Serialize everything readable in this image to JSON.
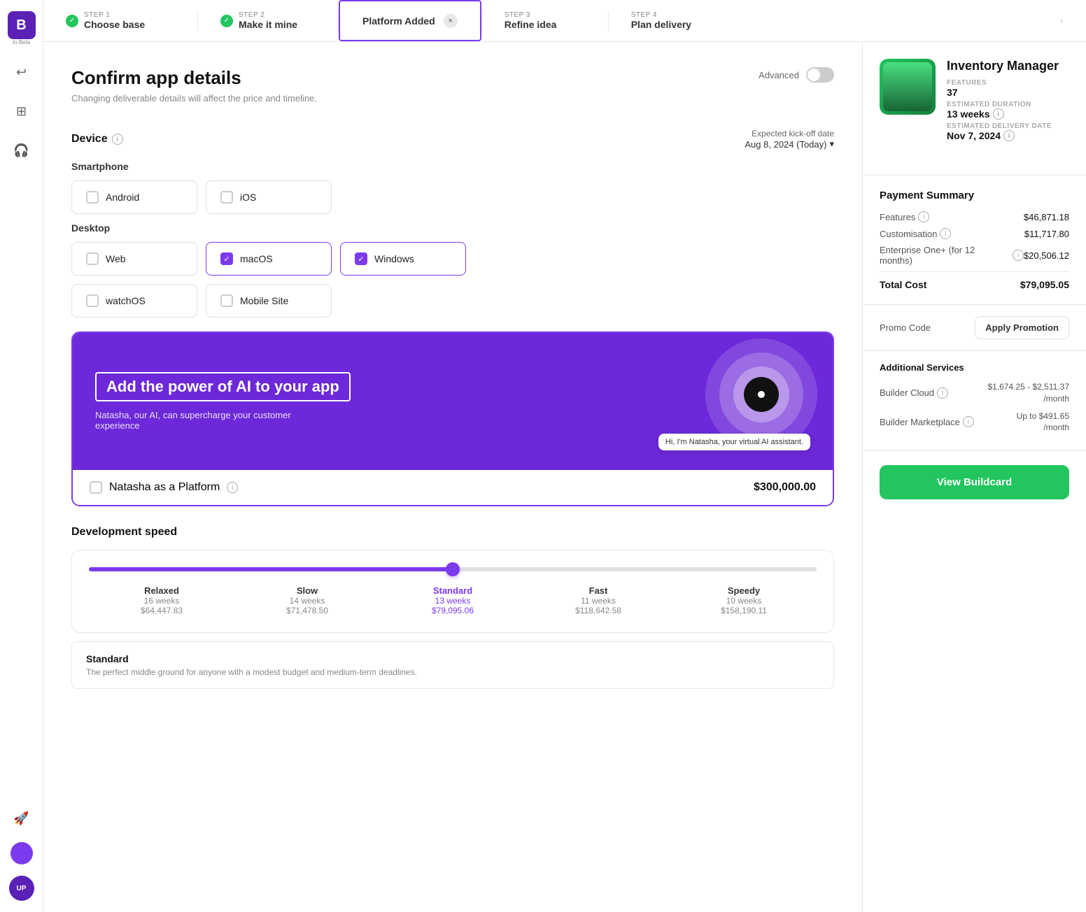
{
  "sidebar": {
    "logo": "B",
    "beta_label": "In Beta",
    "icons": [
      {
        "name": "undo-icon",
        "symbol": "↩"
      },
      {
        "name": "grid-icon",
        "symbol": "⊞"
      },
      {
        "name": "headset-icon",
        "symbol": "🎧"
      }
    ],
    "bottom_icons": [
      {
        "name": "rocket-icon",
        "symbol": "🚀"
      }
    ],
    "avatar_initials": "",
    "up_label": "UP"
  },
  "stepper": {
    "step1": {
      "num": "STEP 1",
      "label": "Choose base",
      "done": true
    },
    "step2": {
      "num": "STEP 2",
      "label": "Make it mine",
      "done": true
    },
    "step3": {
      "num": "",
      "label": "Platform Added",
      "active": true,
      "close": "×"
    },
    "step3b": {
      "num": "STEP 3",
      "label": "Refine idea"
    },
    "step4": {
      "num": "STEP 4",
      "label": "Plan delivery"
    }
  },
  "page": {
    "title": "Confirm app details",
    "subtitle": "Changing deliverable details will affect the price and timeline.",
    "advanced_label": "Advanced"
  },
  "device_section": {
    "title": "Device",
    "kickoff_label": "Expected kick-off date",
    "kickoff_date": "Aug 8, 2024 (Today)",
    "smartphone_label": "Smartphone",
    "desktop_label": "Desktop",
    "platforms": [
      {
        "id": "android",
        "label": "Android",
        "checked": false
      },
      {
        "id": "ios",
        "label": "iOS",
        "checked": false
      },
      {
        "id": "web",
        "label": "Web",
        "checked": false
      },
      {
        "id": "macos",
        "label": "macOS",
        "checked": true
      },
      {
        "id": "windows",
        "label": "Windows",
        "checked": true
      },
      {
        "id": "watchos",
        "label": "watchOS",
        "checked": false
      },
      {
        "id": "mobile-site",
        "label": "Mobile Site",
        "checked": false
      }
    ]
  },
  "ai_banner": {
    "title": "Add the power of AI to your app",
    "description": "Natasha, our AI, can supercharge your customer experience",
    "option_label": "Natasha as a Platform",
    "price": "$300,000.00",
    "bubble_text": "Hi, I'm Natasha, your virtual AI assistant."
  },
  "development_speed": {
    "title": "Development speed",
    "speeds": [
      {
        "name": "Relaxed",
        "weeks": "16 weeks",
        "price": "$64,447.83"
      },
      {
        "name": "Slow",
        "weeks": "14 weeks",
        "price": "$71,478.50"
      },
      {
        "name": "Standard",
        "weeks": "13 weeks",
        "price": "$79,095.06",
        "active": true
      },
      {
        "name": "Fast",
        "weeks": "11 weeks",
        "price": "$118,642.58"
      },
      {
        "name": "Speedy",
        "weeks": "10 weeks",
        "price": "$158,190.11"
      }
    ],
    "standard_title": "Standard",
    "standard_desc": "The perfect middle ground for anyone with a modest budget and medium-term deadlines."
  },
  "right_panel": {
    "app_name": "Inventory Manager",
    "features_label": "FEATURES",
    "features_value": "37",
    "duration_label": "ESTIMATED DURATION",
    "duration_value": "13 weeks",
    "delivery_label": "ESTIMATED DELIVERY DATE",
    "delivery_value": "Nov 7, 2024",
    "payment_summary_title": "Payment Summary",
    "features_cost_label": "Features",
    "features_cost": "$46,871.18",
    "customisation_label": "Customisation",
    "customisation_cost": "$11,717.80",
    "enterprise_label": "Enterprise One+ (for 12 months)",
    "enterprise_cost": "$20,506.12",
    "total_label": "Total Cost",
    "total_cost": "$79,095.05",
    "promo_label": "Promo Code",
    "promo_btn": "Apply Promotion",
    "additional_title": "Additional Services",
    "builder_cloud_label": "Builder Cloud",
    "builder_cloud_price": "$1,674.25 - $2,511.37",
    "builder_cloud_unit": "/month",
    "builder_marketplace_label": "Builder Marketplace",
    "builder_marketplace_price": "Up to $491.65",
    "builder_marketplace_unit": "/month",
    "view_btn": "View Buildcard"
  }
}
